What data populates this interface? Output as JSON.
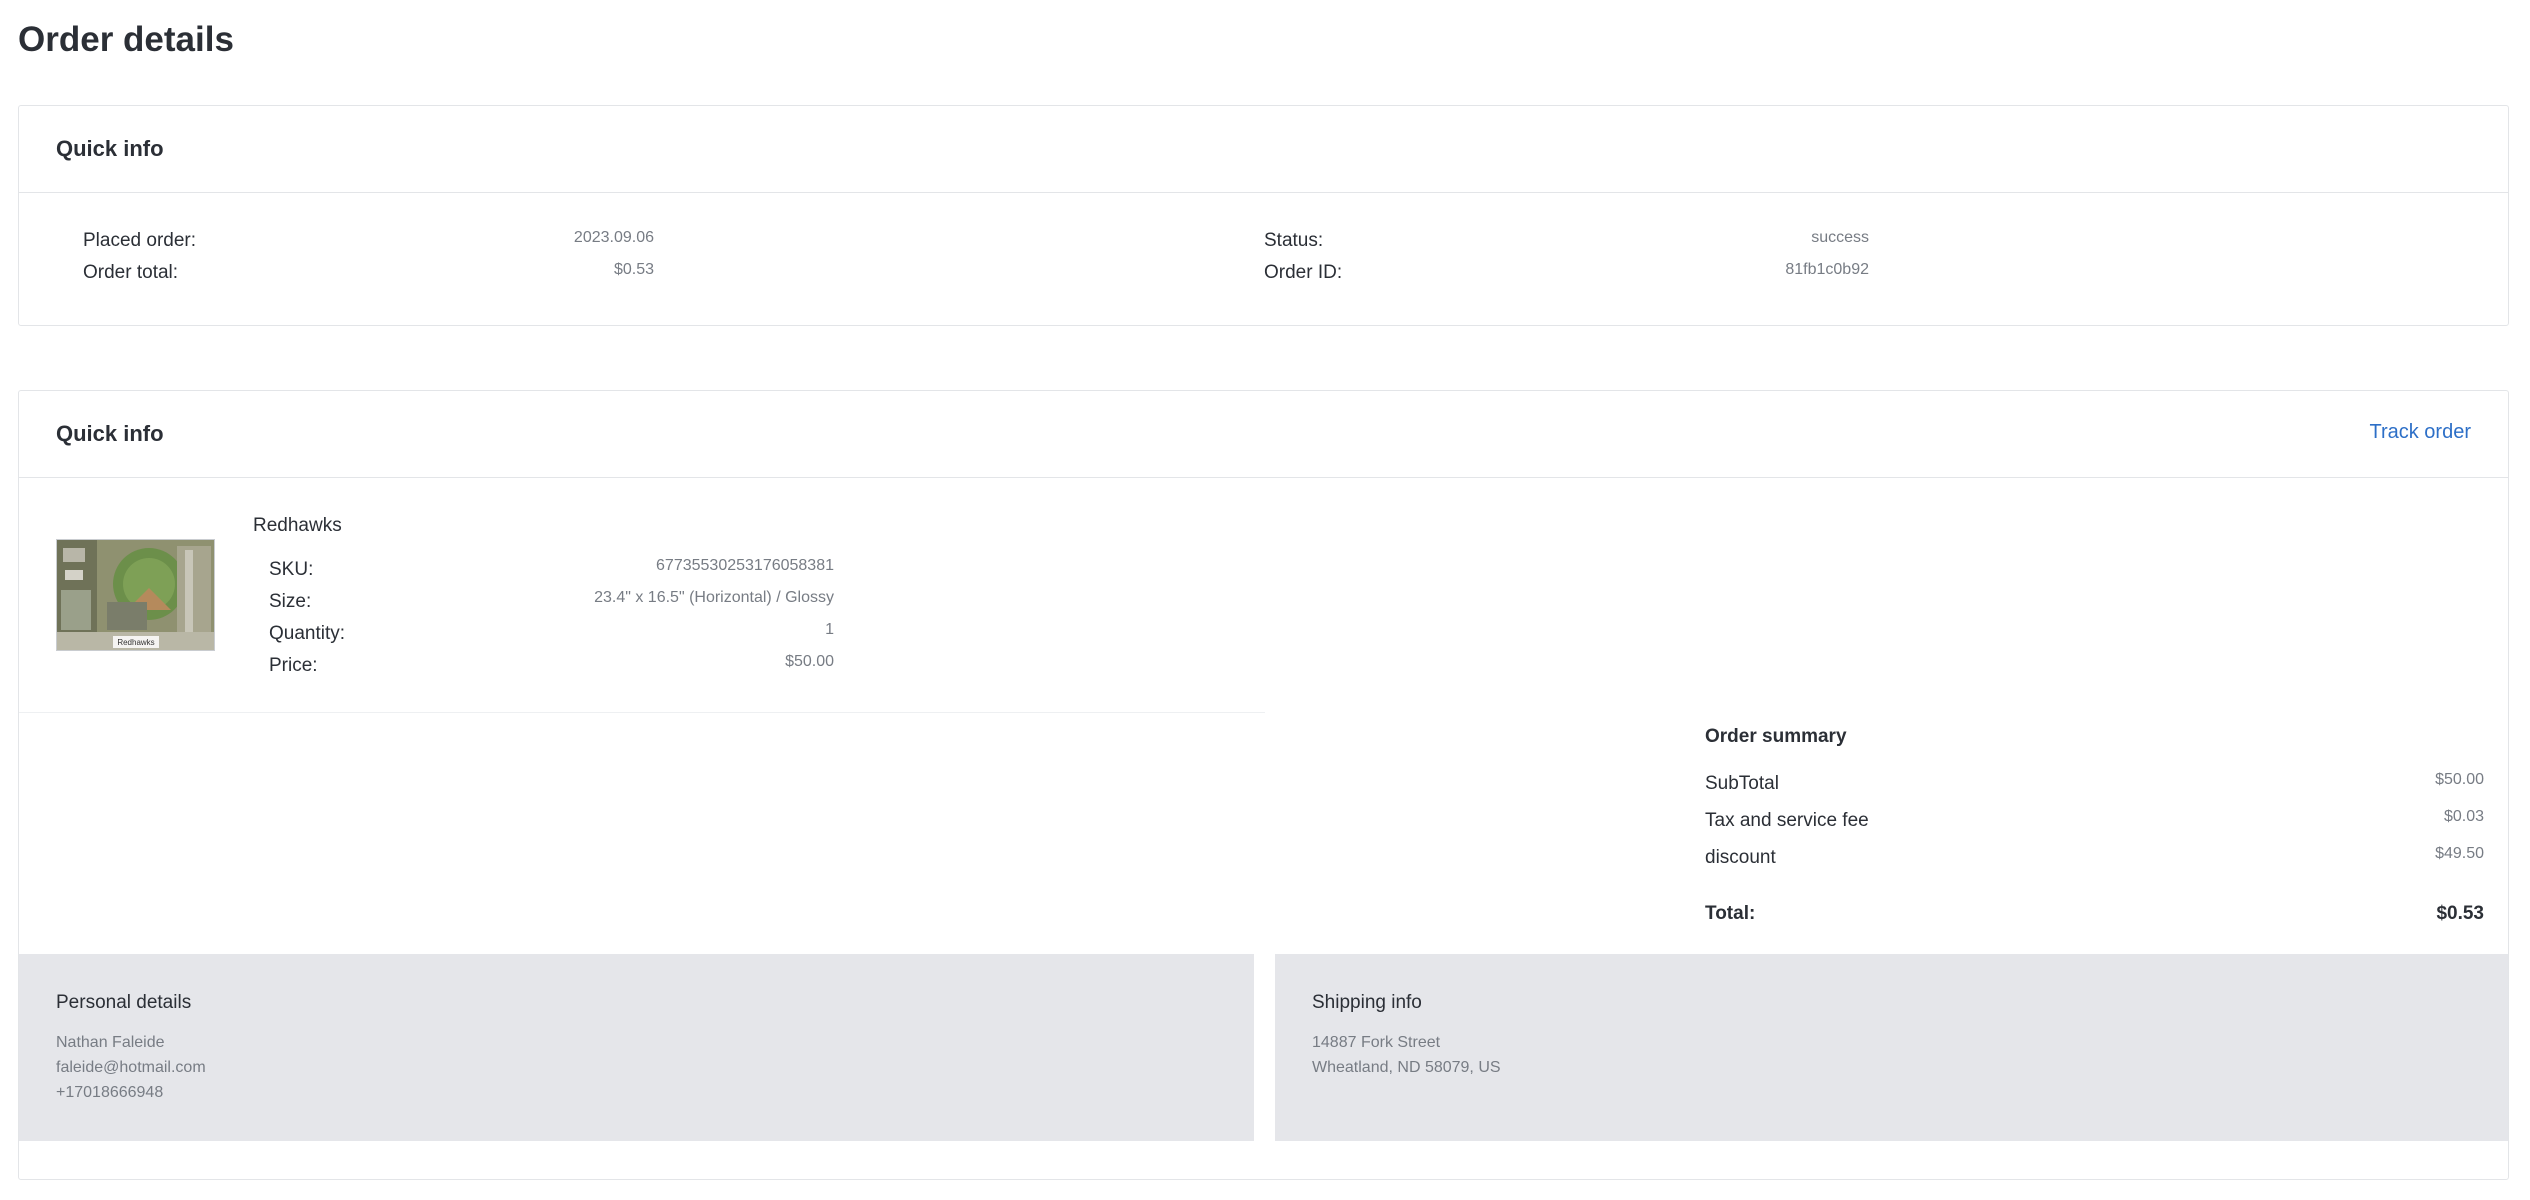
{
  "page": {
    "title": "Order details"
  },
  "quick_info": {
    "title": "Quick info",
    "placed_order_label": "Placed order:",
    "placed_order_value": "2023.09.06",
    "order_total_label": "Order total:",
    "order_total_value": "$0.53",
    "status_label": "Status:",
    "status_value": "success",
    "order_id_label": "Order ID:",
    "order_id_value": "81fb1c0b92"
  },
  "items_section": {
    "title": "Quick info",
    "track_order_label": "Track order",
    "item": {
      "name": "Redhawks",
      "sku_label": "SKU:",
      "sku_value": "67735530253176058381",
      "size_label": "Size:",
      "size_value": "23.4\" x 16.5\" (Horizontal) / Glossy",
      "quantity_label": "Quantity:",
      "quantity_value": "1",
      "price_label": "Price:",
      "price_value": "$50.00",
      "thumbnail_caption": "Redhawks"
    }
  },
  "order_summary": {
    "title": "Order summary",
    "rows": [
      {
        "label": "SubTotal",
        "value": "$50.00"
      },
      {
        "label": "Tax and service fee",
        "value": "$0.03"
      },
      {
        "label": "discount",
        "value": "$49.50"
      }
    ],
    "total_label": "Total:",
    "total_value": "$0.53"
  },
  "personal_details": {
    "title": "Personal details",
    "name": "Nathan Faleide",
    "email": "faleide@hotmail.com",
    "phone": "+17018666948"
  },
  "shipping_info": {
    "title": "Shipping info",
    "address_line1": "14887 Fork Street",
    "address_line2": "Wheatland, ND 58079, US"
  },
  "colors": {
    "link": "#2d6fc7",
    "panel_background": "#e5e6ea",
    "muted_text": "#777c84",
    "border": "#e3e5e8"
  }
}
